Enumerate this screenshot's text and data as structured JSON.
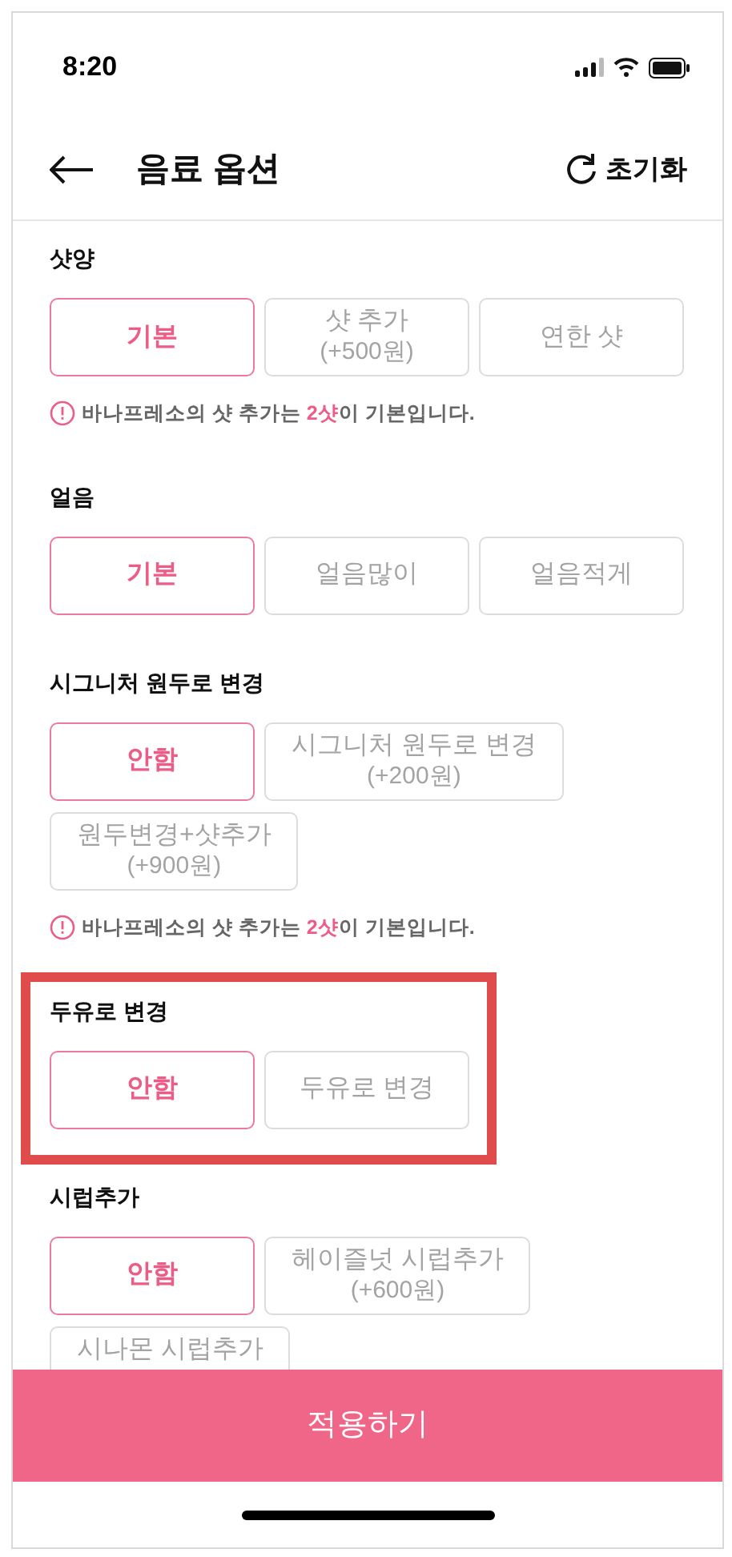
{
  "status_bar": {
    "time": "8:20"
  },
  "header": {
    "title": "음료 옵션",
    "reset": "초기화"
  },
  "sections": [
    {
      "title": "샷양",
      "highlighted": false,
      "options": [
        {
          "label": "기본",
          "selected": true
        },
        {
          "label": "샷 추가",
          "price": "(+500원)",
          "selected": false
        },
        {
          "label": "연한 샷",
          "selected": false
        }
      ],
      "note": "바나프레소의 샷 추가는 **2샷**이 기본입니다."
    },
    {
      "title": "얼음",
      "highlighted": false,
      "options": [
        {
          "label": "기본",
          "selected": true
        },
        {
          "label": "얼음많이",
          "selected": false
        },
        {
          "label": "얼음적게",
          "selected": false
        }
      ]
    },
    {
      "title": "시그니처 원두로 변경",
      "highlighted": false,
      "options": [
        {
          "label": "안함",
          "selected": true
        },
        {
          "label": "시그니처 원두로 변경",
          "price": "(+200원)",
          "selected": false
        },
        {
          "label": "원두변경+샷추가",
          "price": "(+900원)",
          "selected": false
        }
      ],
      "note": "바나프레소의 샷 추가는 **2샷**이 기본입니다."
    },
    {
      "title": "두유로 변경",
      "highlighted": true,
      "options": [
        {
          "label": "안함",
          "selected": true
        },
        {
          "label": "두유로 변경",
          "selected": false
        }
      ]
    },
    {
      "title": "시럽추가",
      "highlighted": false,
      "options": [
        {
          "label": "안함",
          "selected": true
        },
        {
          "label": "헤이즐넛 시럽추가",
          "price": "(+600원)",
          "selected": false
        },
        {
          "label": "시나몬 시럽추가",
          "selected": false,
          "cut_off": true
        }
      ]
    }
  ],
  "apply_button": "적용하기"
}
